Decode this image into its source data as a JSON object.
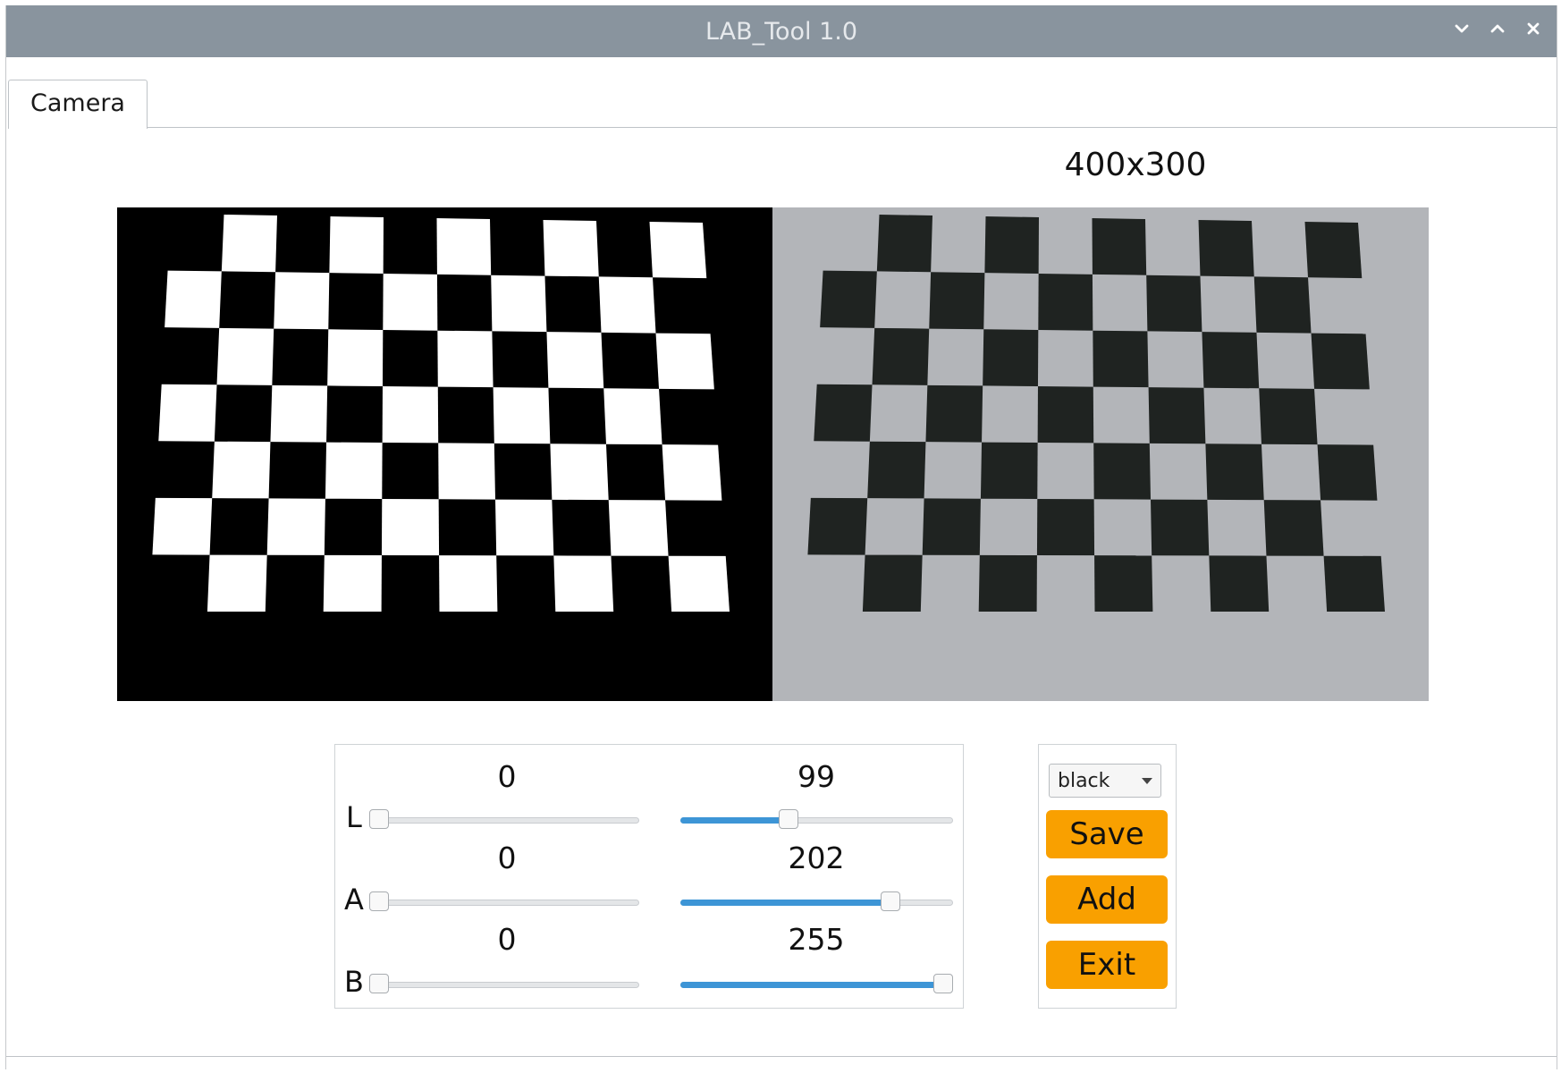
{
  "window": {
    "title": "LAB_Tool 1.0",
    "controls": [
      "minimize-icon",
      "maximize-icon",
      "close-icon"
    ]
  },
  "tabs": [
    {
      "label": "Camera",
      "active": true
    }
  ],
  "camera": {
    "resolution": "400x300",
    "preview_left": "binary mask (white squares on black)",
    "preview_right": "camera image of checkerboard"
  },
  "sliders": {
    "range": [
      0,
      255
    ],
    "rows": [
      {
        "channel": "L",
        "min_value": "0",
        "max_value": "99",
        "min_fraction": 0.0,
        "max_fraction": 0.388
      },
      {
        "channel": "A",
        "min_value": "0",
        "max_value": "202",
        "min_fraction": 0.0,
        "max_fraction": 0.792
      },
      {
        "channel": "B",
        "min_value": "0",
        "max_value": "255",
        "min_fraction": 0.0,
        "max_fraction": 1.0
      }
    ]
  },
  "controls": {
    "color_select": "black",
    "save_label": "Save",
    "add_label": "Add",
    "exit_label": "Exit"
  },
  "colors": {
    "titlebar": "#89949e",
    "accent_button": "#f9a000",
    "slider_fill": "#3d95d6"
  }
}
